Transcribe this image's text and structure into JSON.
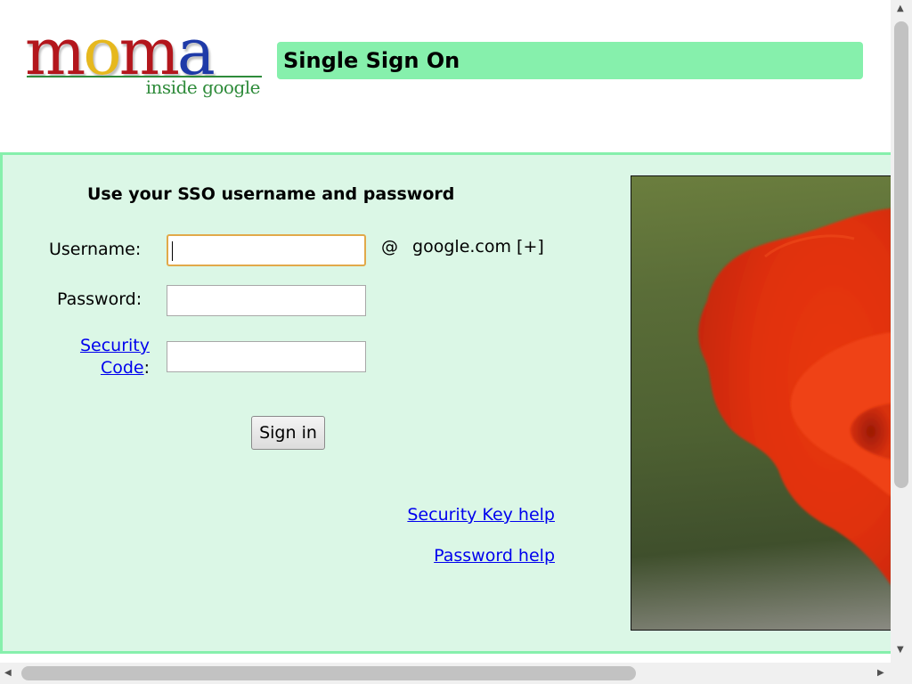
{
  "header": {
    "logo_word": "moma",
    "logo_sub": "inside google",
    "title": "Single Sign On"
  },
  "form": {
    "heading": "Use your SSO username and password",
    "username_label": "Username:",
    "username_value": "",
    "domain_at": "@",
    "domain": "google.com [+]",
    "password_label": "Password:",
    "password_value": "",
    "security_code_link_part1": "Security",
    "security_code_link_part2": "Code",
    "security_code_colon": ":",
    "security_code_value": "",
    "sign_in": "Sign in"
  },
  "help": {
    "security_key": "Security Key help",
    "password": "Password help"
  },
  "colors": {
    "title_bar": "#86f0ac",
    "panel_bg": "#dbf7e6",
    "link": "#0000ee",
    "focus_border": "#e1a94a"
  },
  "icons": {
    "scroll_up": "triangle-up",
    "scroll_down": "triangle-down",
    "scroll_left": "triangle-left",
    "scroll_right": "triangle-right"
  }
}
